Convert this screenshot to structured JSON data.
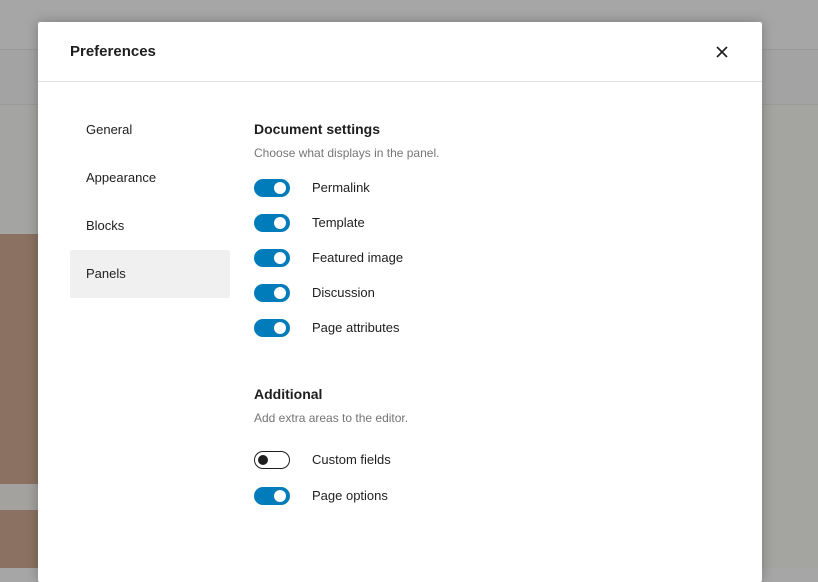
{
  "modal": {
    "title": "Preferences",
    "close_icon": "close-icon"
  },
  "nav": {
    "items": [
      {
        "label": "General",
        "active": false
      },
      {
        "label": "Appearance",
        "active": false
      },
      {
        "label": "Blocks",
        "active": false
      },
      {
        "label": "Panels",
        "active": true
      }
    ]
  },
  "sections": {
    "document": {
      "title": "Document settings",
      "description": "Choose what displays in the panel.",
      "toggles": [
        {
          "label": "Permalink",
          "checked": true
        },
        {
          "label": "Template",
          "checked": true
        },
        {
          "label": "Featured image",
          "checked": true
        },
        {
          "label": "Discussion",
          "checked": true
        },
        {
          "label": "Page attributes",
          "checked": true
        }
      ]
    },
    "additional": {
      "title": "Additional",
      "description": "Add extra areas to the editor.",
      "toggles": [
        {
          "label": "Custom fields",
          "checked": false
        },
        {
          "label": "Page options",
          "checked": true
        }
      ]
    }
  },
  "colors": {
    "accent": "#007cba",
    "text": "#1e1e1e",
    "muted": "#757575",
    "active_nav_bg": "#f0f0f0"
  }
}
